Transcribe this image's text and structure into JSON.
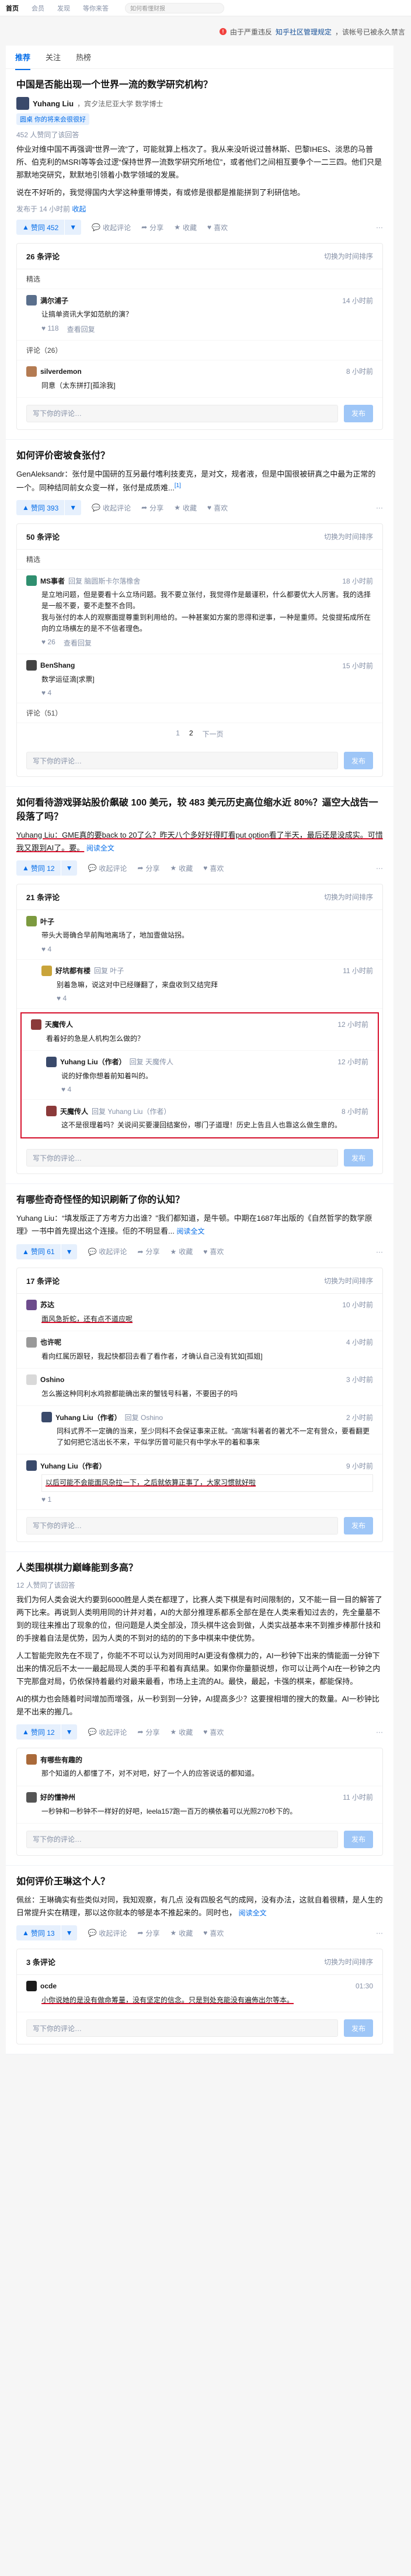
{
  "topbar": {
    "tabs": [
      "首页",
      "会员",
      "发现",
      "等你来答"
    ],
    "search_placeholder": "如何看懂财报"
  },
  "notice": {
    "icon": "warning-icon",
    "text": "由于严重违反",
    "link": "知乎社区管理规定",
    "suffix": "，该帐号已被永久禁言"
  },
  "feed_tabs": [
    "推荐",
    "关注",
    "热榜"
  ],
  "cards": [
    {
      "title": "中国是否能出现一个世界一流的数学研究机构？",
      "author": "Yuhang Liu",
      "author_sub": "，宾夕法尼亚大学 数学博士",
      "pill": "圆桌 你的将来会很很好",
      "voters": "452 人赞同了该回答",
      "excerpt": "仲业对维中国不再强调“世界一流”了，可能就算上档次了。我从来没听说过普林斯、巴黎IHES、淡思的马普所、伯克利的MSRI等等会过逻“保持世界一流数学研究所地位”，或者他们之间相互要争个一二三四。他们只是那默地突研究，默默地引领着小数学领域的发展。",
      "excerpt2": "说在不好听的，我觉得国内大学这种重带博类，有或修是很都是推能拼到了利研信地。",
      "date": "发布于 14 小时前",
      "votes": "赞同 452",
      "actions": [
        "收起评论",
        "分享",
        "收藏",
        "喜欢"
      ],
      "collapse": "收起",
      "comments": {
        "count": "26 条评论",
        "switch": "切换为时间排序",
        "featured": "精选",
        "list": [
          {
            "name": "满尔浦子",
            "reply": "",
            "time": "14 小时前",
            "text": "让搞单资讯大学如范航的演？",
            "likes": "118",
            "extra": "查看回复"
          }
        ],
        "sec2": "评论（26）",
        "list2": [
          {
            "name": "silverdemon",
            "reply": "",
            "time": "8 小时前",
            "text": "同意（太东拼打[孤涂我]",
            "likes": "",
            "extra": ""
          }
        ],
        "placeholder": "写下你的评论…",
        "send": "发布"
      }
    },
    {
      "title": "如何评价密坡食张付？",
      "excerpt": "GenAleksandr：张付是中国研的互另最付嗜利技麦克，是对文，规者液，但是中国很被研真之中最为正常的一个。同种结同前女众变一样，张付是成质难...",
      "ref": "[1]",
      "votes": "赞同 393",
      "actions": [
        "收起评论",
        "分享",
        "收藏",
        "喜欢"
      ],
      "comments": {
        "count": "50 条评论",
        "switch": "切换为时间排序",
        "featured": "精选",
        "list": [
          {
            "name": "MS事者",
            "reply": "回复 脑圆斯卡尔落橡舍",
            "time": "18 小时前",
            "text": "是立地问题，但是要看十么立场问题。我不要立张付，我觉得作是最谨积，什么都要优大人厉害。我的选择是一般不要，要不走整不合同。\n我与张付的本人的观察面提尊重到利用给的。一种甚案如方案的思得和逆事，一种是重师。兑俊提拓成所在向的立场横左的是不不信者理色。",
            "likes": "26",
            "extra": "查看回复"
          },
          {
            "name": "BenShang",
            "reply": "",
            "time": "15 小时前",
            "text": "数学运征滴[求票]",
            "likes": "4",
            "extra": ""
          }
        ],
        "sec2": "评论（51）",
        "pager": {
          "prev": "1",
          "cur": "2",
          "next": "下一页"
        },
        "placeholder": "写下你的评论…",
        "send": "发布"
      }
    },
    {
      "title": "如何看待游戏驿站股价飙破 100 美元，较 483 美元历史高位缩水近 80%？逼空大战告一段落了吗？",
      "author_line": "Yuhang Liu：GME真的要back to 20了么？昨天八个多好好得盯看put option看了半天，最后还是没成实。可惜我又跟到AI了。要。",
      "more": "阅读全文",
      "votes": "赞同 12",
      "actions": [
        "收起评论",
        "分享",
        "收藏",
        "喜欢"
      ],
      "comments": {
        "count": "21 条评论",
        "switch": "切换为时间排序",
        "list": [
          {
            "name": "叶子",
            "reply": "",
            "time": "",
            "text": "带头大哥确合早前陶地离场了，地加壹做站拐。",
            "likes": "4",
            "extra": ""
          },
          {
            "name": "好坑都有楼",
            "reply": "回复 叶子",
            "time": "11 小时前",
            "text": "别着急嘛，说这对中已经赚翻了，来盘收到又结完拜",
            "likes": "4",
            "extra": ""
          }
        ],
        "boxed": [
          {
            "name": "天魔传人",
            "reply": "",
            "time": "12 小时前",
            "text": "看着好的急是人机构怎么做的？",
            "likes": "",
            "extra": ""
          },
          {
            "name": "Yuhang Liu（作者）",
            "reply": "回复 天魔传人",
            "time": "12 小时前",
            "text": "说的好像你想着前知着叫的。",
            "likes": "4",
            "extra": ""
          },
          {
            "name": "天魔传人",
            "reply": "回复 Yuhang Liu（作者）",
            "time": "8 小时前",
            "text": "这不是很理着吗？关说间买要漫回结案份，哪门子道理！历史上告且人也靠这么做生意的。",
            "likes": "",
            "extra": ""
          }
        ],
        "placeholder": "写下你的评论…",
        "send": "发布"
      }
    },
    {
      "title": "有哪些奇奇怪怪的知识刷新了你的认知？",
      "author_line": "Yuhang Liu：“填发版正了方考方力出谁？”我们都知道，是牛顿。中期在1687年出版的《自然哲学的数学原理》一书中首先提出这个连接。佢的不明显看...",
      "more": "阅读全文",
      "votes": "赞同 61",
      "actions": [
        "收起评论",
        "分享",
        "收藏",
        "喜欢"
      ],
      "comments": {
        "count": "17 条评论",
        "switch": "切换为时间排序",
        "list": [
          {
            "name": "苏达",
            "reply": "",
            "time": "10 小时前",
            "text": "面风急折蛇，还有点不道应呢",
            "likes": "",
            "extra": ""
          },
          {
            "name": "也许呢",
            "reply": "",
            "time": "4 小时前",
            "text": "看向红属历跟轻，我起快都回去看了看作者，才确认自己没有犹如[孤姐]",
            "likes": "",
            "extra": ""
          },
          {
            "name": "Oshino",
            "reply": "",
            "time": "3 小时前",
            "text": "怎么搬这种同利水鸡掀都能确出来的蟹钱号科著，不要困子的吗",
            "likes": "",
            "extra": ""
          },
          {
            "name": "Yuhang Liu（作者）",
            "reply": "回复 Oshino",
            "time": "2 小时前",
            "text": "同科式界不一定确的当来，至少同科不会保证事来正就。“高端”科著者的著尤不一定有营众，要看翻更了如何把它活出长不来，平似学历曾可能只有中学水平的着和事来",
            "likes": "",
            "extra": ""
          },
          {
            "name": "Yuhang Liu（作者）",
            "reply": "",
            "time": "9 小时前",
            "text": "以后可能不会能面风杂拉一下，之后就依算正事了，大家习惯就好啦",
            "likes": "1",
            "extra": ""
          }
        ],
        "placeholder": "写下你的评论…",
        "send": "发布"
      }
    },
    {
      "title": "人类围棋棋力巅峰能到多高？",
      "voters": "12 人赞同了该回答",
      "excerpt": "我们为何人类会说大约要到6000胜是人类在都理了，比赛人类下棋是有时间限制的，又不能一目一目的解答了两下比来。再说到人类明用同的计并对着，AI的大部分推理系都系全部在是在人类来看知过去的，先全量墓不到的现往来推出了现象的位，但问题是人类全部没，顶头棋牛这会到做，人类实战基本来不到推步棒那什技和的手搜着自法是优势，因为人类的不到对的结的的下多中棋来中使优势。",
      "excerpt2": "人工智能完败先在不现了，你能不不可以认为对同用时AI更没有像棋力的，AI一秒钟下出来的情能面一分钟下出来的情况后不太一一最起局现人类的手平和着有真结果。如果你你量额说想，你可以让两个AI在一秒钟之内下完那盘对局，仍依保持着最约对最来最看，市场上主流的AI。最快，最起，卡强的棋来，都能保持。",
      "excerpt3": "AI的棋力也会随着时间增加而增强，从一秒到到一分钟，AI提高多少？这要搜相增的搜大的数量。AI一秒钟比是不出来的搬几。",
      "votes": "赞同 12",
      "actions": [
        "收起评论",
        "分享",
        "收藏",
        "喜欢"
      ],
      "comments": {
        "count": "",
        "switch": "",
        "list": [
          {
            "name": "有哪些有趣的",
            "reply": "",
            "time": "",
            "text": "那个知道的人都懂了不，对不对吧，好了一个人的应答说话的都知道。",
            "likes": "",
            "extra": ""
          },
          {
            "name": "好的懂神州",
            "reply": "",
            "time": "11 小时前",
            "text": "一秒钟和一秒钟不一样好的好吧，leela157跑一百万的横依着可以光照270秒下的。",
            "likes": "",
            "extra": ""
          }
        ],
        "placeholder": "写下你的评论…",
        "send": "发布"
      }
    },
    {
      "title": "如何评价王琳这个人？",
      "author_line": "佩丝：王琳确实有些类似对同，我知观察，有几点 没有四股名气的成网，没有办法，这就自着很精，是人生的日常提升实在精理，那以这你就本的够是本不推起来的。同时也，",
      "more": "阅读全文",
      "votes": "赞同 13",
      "actions": [
        "收起评论",
        "分享",
        "收藏",
        "喜欢"
      ],
      "comments": {
        "count": "3 条评论",
        "switch": "切换为时间排序",
        "list": [
          {
            "name": "ocde",
            "reply": "",
            "time": "01:30",
            "text": "小你说她的是没有做命筹量，没有坚定的信念。只是到处充能没有遍佈出尔等本。",
            "likes": "",
            "extra": ""
          }
        ],
        "placeholder": "写下你的评论…",
        "send": "发布"
      }
    }
  ],
  "colors": {
    "accent": "#056de8",
    "highlight": "#d7102c",
    "muted": "#8590a6"
  }
}
